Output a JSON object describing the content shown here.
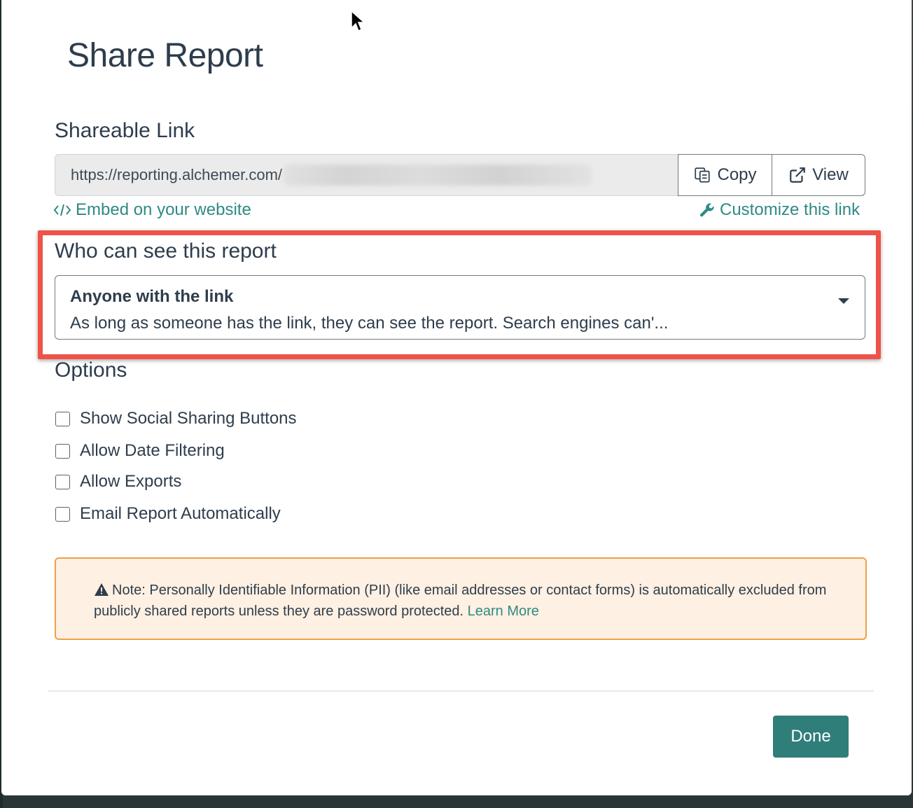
{
  "modal": {
    "title": "Share Report"
  },
  "shareable_link": {
    "label": "Shareable Link",
    "url_prefix": "https://reporting.alchemer.com/",
    "copy_label": "Copy",
    "view_label": "View",
    "embed_label": "Embed on your website",
    "customize_label": "Customize this link"
  },
  "visibility": {
    "label": "Who can see this report",
    "selected_title": "Anyone with the link",
    "selected_description": "As long as someone has the link, they can see the report. Search engines can'..."
  },
  "options": {
    "label": "Options",
    "items": [
      {
        "label": "Show Social Sharing Buttons",
        "checked": false
      },
      {
        "label": "Allow Date Filtering",
        "checked": false
      },
      {
        "label": "Allow Exports",
        "checked": false
      },
      {
        "label": "Email Report Automatically",
        "checked": false
      }
    ]
  },
  "note": {
    "text": "Note: Personally Identifiable Information (PII) (like email addresses or contact forms) is automatically excluded from publicly shared reports unless they are password protected.",
    "learn_more": "Learn More"
  },
  "footer": {
    "done_label": "Done"
  },
  "colors": {
    "accent_teal": "#2f8a84",
    "done_button": "#2f7e7a",
    "highlight_red": "#f05249",
    "note_background": "#fef0e2",
    "note_border": "#f0a04a"
  }
}
